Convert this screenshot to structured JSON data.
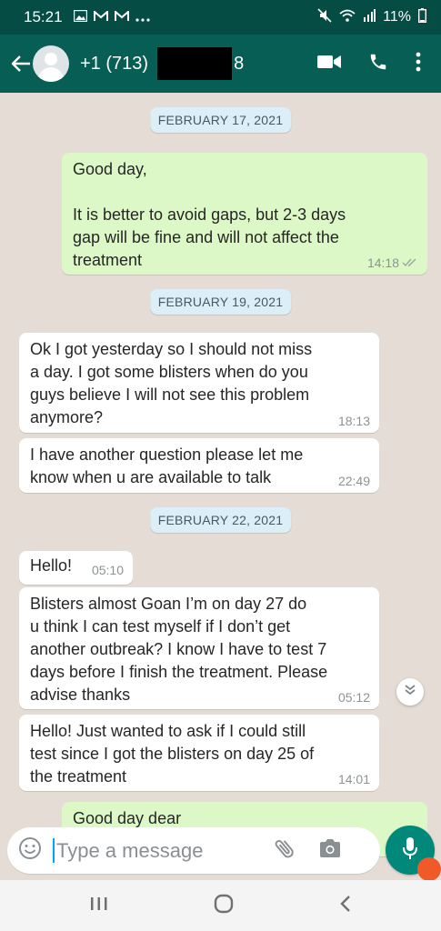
{
  "status_bar": {
    "time": "15:21",
    "left_icons": [
      "image-icon",
      "gmail-icon",
      "gmail-icon",
      "more-dots-icon"
    ],
    "right_icons": [
      "mute-icon",
      "wifi-icon",
      "signal-icon"
    ],
    "battery": "11%"
  },
  "header": {
    "contact_prefix": "+1 (713)",
    "contact_suffix": "8"
  },
  "dates": [
    "FEBRUARY 17, 2021",
    "FEBRUARY 19, 2021",
    "FEBRUARY 22, 2021"
  ],
  "messages": [
    {
      "text": "Good day,\n\nIt is better to avoid gaps, but 2-3 days\ngap will be fine and will not affect the\ntreatment",
      "time": "14:18",
      "direction": "outgoing"
    },
    {
      "text": "Ok I got yesterday so I should not miss\na day. I got some blisters when do you\nguys believe I will not see this problem\nanymore?",
      "time": "18:13",
      "direction": "incoming"
    },
    {
      "text": "I have another question please let me\nknow when u are available to talk",
      "time": "22:49",
      "direction": "incoming"
    },
    {
      "text": "Hello!",
      "time": "05:10",
      "direction": "incoming"
    },
    {
      "text": "Blisters almost Goan I’m on day 27 do\nu think I can test myself if I don’t get\nanother outbreak? I know I have to test 7\ndays before I finish the treatment. Please\nadvise thanks",
      "time": "05:12",
      "direction": "incoming"
    },
    {
      "text": "Hello! Just wanted to ask if I could still\ntest since I got the blisters on day 25 of\nthe treatment",
      "time": "14:01",
      "direction": "incoming"
    },
    {
      "text": "Good day dear",
      "time": "",
      "direction": "outgoing"
    }
  ],
  "composer": {
    "placeholder": "Type a message"
  },
  "colors": {
    "header": "#075e54",
    "status_bar": "#054d44",
    "chat_background": "#e5ddd5",
    "outgoing_bubble": "#dcf8c6",
    "incoming_bubble": "#ffffff",
    "date_chip": "#dceef8",
    "mic_button": "#00897b"
  }
}
